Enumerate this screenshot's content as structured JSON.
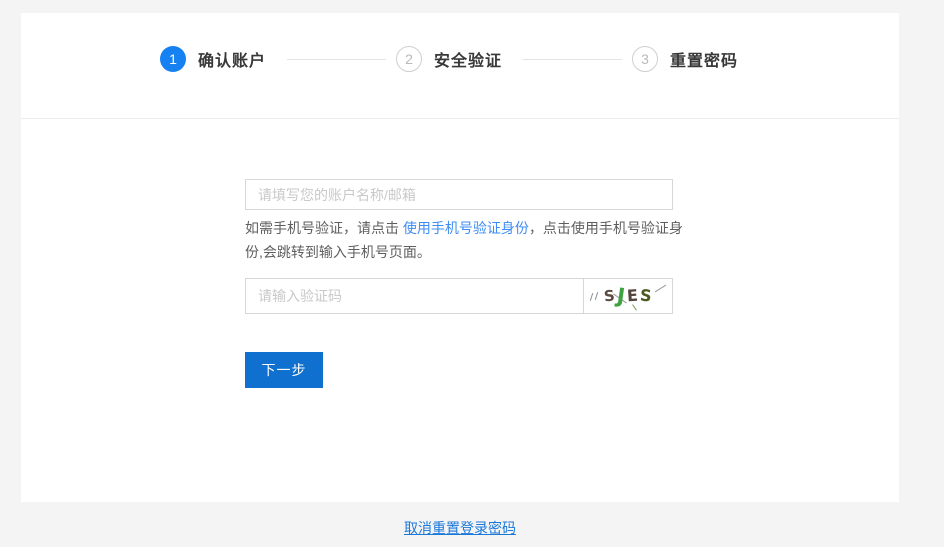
{
  "page": {
    "background": "#f4f4f5",
    "cancel_link": "取消重置登录密码"
  },
  "stepper": {
    "steps": [
      {
        "num": "1",
        "label": "确认账户",
        "active": true
      },
      {
        "num": "2",
        "label": "安全验证",
        "active": false
      },
      {
        "num": "3",
        "label": "重置密码",
        "active": false
      }
    ]
  },
  "form": {
    "account_placeholder": "请填写您的账户名称/邮箱",
    "helper_prefix": "如需手机号验证，请点击 ",
    "helper_link": "使用手机号验证身份",
    "helper_suffix": "，点击使用手机号验证身份,会跳转到输入手机号页面。",
    "captcha_placeholder": "请输入验证码",
    "next_button": "下一步"
  },
  "captcha": {
    "text": "SJES",
    "letters": [
      {
        "ch": "S",
        "color": "#5d4b41",
        "size": 15,
        "rotate": -6
      },
      {
        "ch": "J",
        "color": "#3ea23e",
        "size": 21,
        "rotate": 8
      },
      {
        "ch": "E",
        "color": "#53443c",
        "size": 16,
        "rotate": -4
      },
      {
        "ch": "S",
        "color": "#4c5a20",
        "size": 16,
        "rotate": 5
      }
    ]
  },
  "colors": {
    "step_active": "#1681f2",
    "button": "#1070d0",
    "helper_link": "#3c8df6",
    "cancel_link": "#1a78d9"
  }
}
